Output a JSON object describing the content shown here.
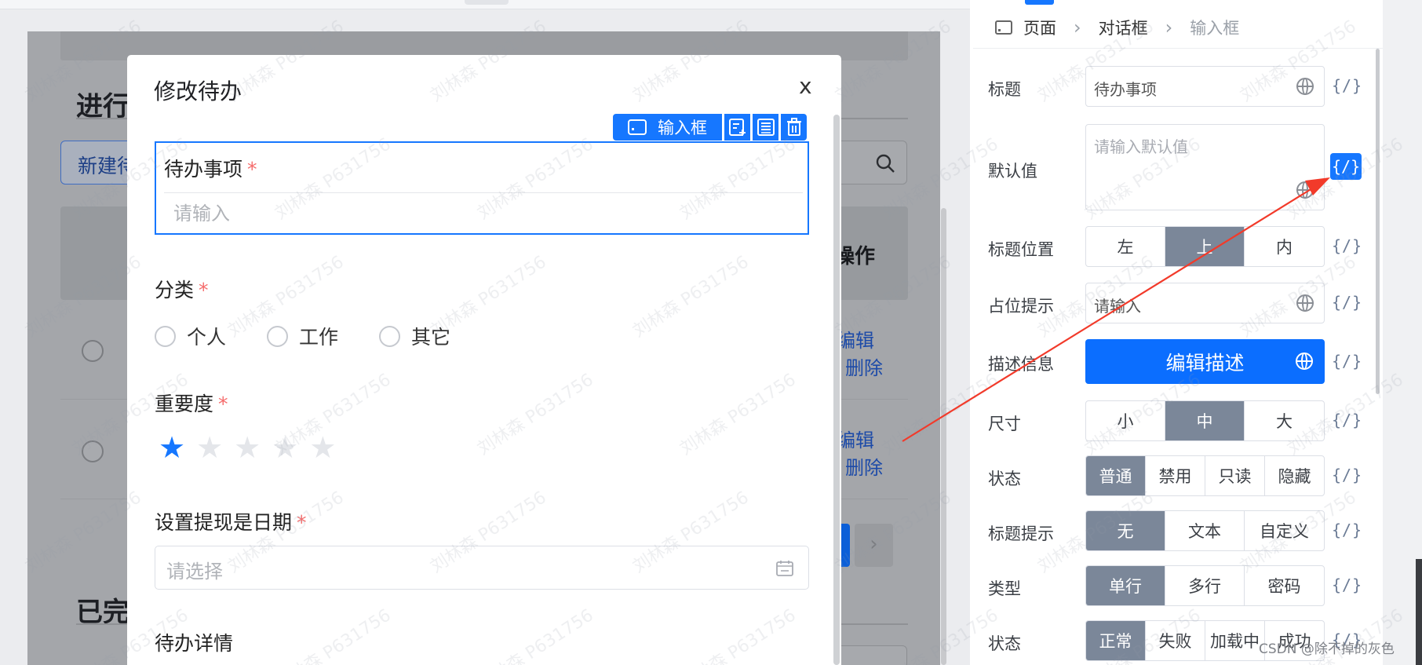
{
  "dialog": {
    "title": "修改待办",
    "close": "x",
    "toolbar_label": "输入框",
    "toolbar_icons": [
      "add-field-icon",
      "copy-icon",
      "delete-icon"
    ],
    "field1": {
      "label": "待办事项",
      "required": "*",
      "placeholder": "请输入"
    },
    "field2": {
      "label": "分类",
      "required": "*",
      "options": [
        "个人",
        "工作",
        "其它"
      ]
    },
    "field3": {
      "label": "重要度",
      "required": "*",
      "rating": 1,
      "max": 5
    },
    "field4": {
      "label": "设置提现是日期",
      "required": "*",
      "placeholder": "请选择"
    },
    "field5": {
      "label": "待办详情"
    }
  },
  "background": {
    "section1_title": "进行",
    "new_button": "新建待",
    "ops_header": "操作",
    "edit": "编辑",
    "delete": "删除",
    "section2_title": "已完",
    "next": "›"
  },
  "panel": {
    "breadcrumb": [
      "页面",
      "对话框",
      "输入框"
    ],
    "code_label": "{/}",
    "title_label": "标题",
    "title_value": "待办事项",
    "default_label": "默认值",
    "default_placeholder": "请输入默认值",
    "title_pos_label": "标题位置",
    "title_pos": [
      "左",
      "上",
      "内"
    ],
    "placeholder_label": "占位提示",
    "placeholder_value": "请输入",
    "desc_label": "描述信息",
    "desc_button": "编辑描述",
    "size_label": "尺寸",
    "size": [
      "小",
      "中",
      "大"
    ],
    "state_label": "状态",
    "state": [
      "普通",
      "禁用",
      "只读",
      "隐藏"
    ],
    "tip_label": "标题提示",
    "tip": [
      "无",
      "文本",
      "自定义"
    ],
    "type_label": "类型",
    "type": [
      "单行",
      "多行",
      "密码"
    ],
    "status_label": "状态",
    "status": [
      "正常",
      "失败",
      "加载中",
      "成功"
    ]
  },
  "watermark": {
    "text": "刘林森 P631756",
    "credit": "CSDN @除不掉的灰色"
  },
  "colors": {
    "accent": "#1677ff",
    "segment_active": "#7b8799",
    "required": "#f56c6c",
    "arrow": "#f23a2a"
  }
}
